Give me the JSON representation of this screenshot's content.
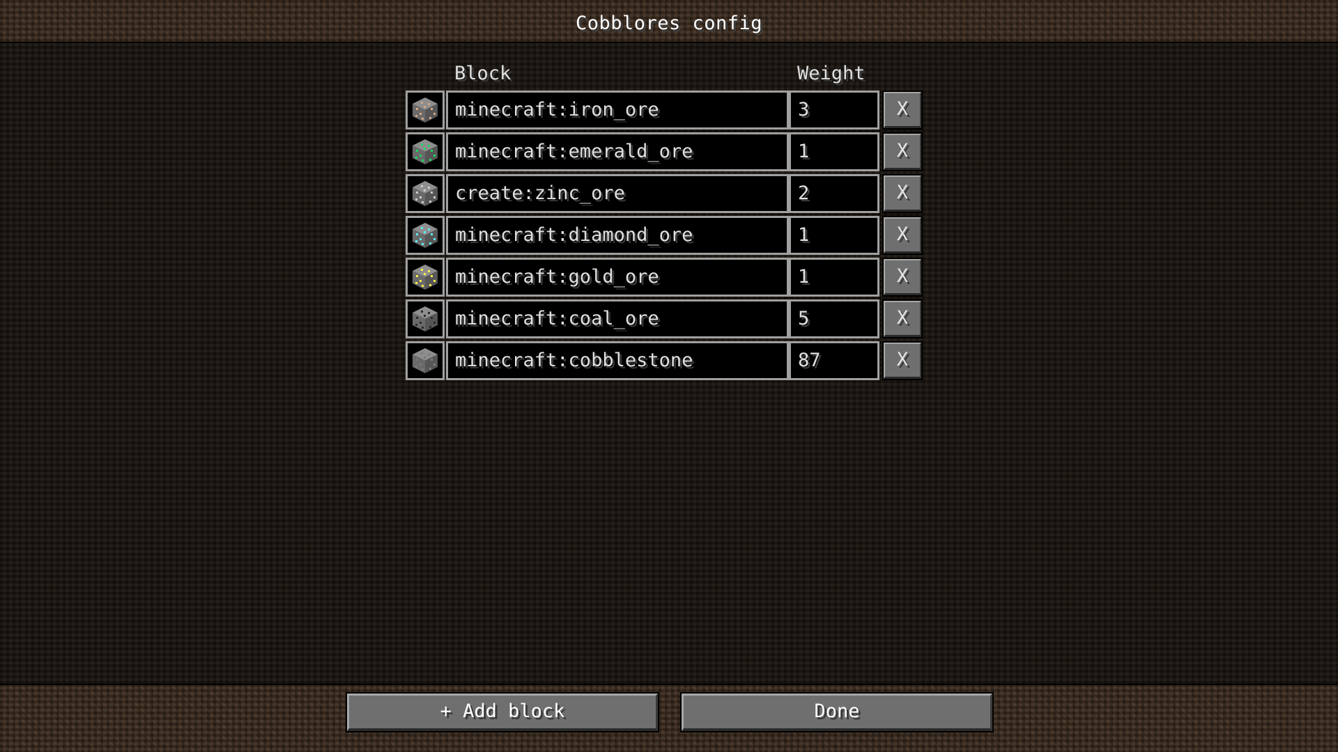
{
  "window": {
    "title": "Cobblores config"
  },
  "columns": {
    "block": "Block",
    "weight": "Weight"
  },
  "rows": [
    {
      "block": "minecraft:iron_ore",
      "weight": "3",
      "icon": "iron-ore-icon",
      "ore_color": "#d8a884",
      "remove_label": "X"
    },
    {
      "block": "minecraft:emerald_ore",
      "weight": "1",
      "icon": "emerald-ore-icon",
      "ore_color": "#17dd62",
      "remove_label": "X"
    },
    {
      "block": "create:zinc_ore",
      "weight": "2",
      "icon": "zinc-ore-icon",
      "ore_color": "#c8d0c8",
      "remove_label": "X"
    },
    {
      "block": "minecraft:diamond_ore",
      "weight": "1",
      "icon": "diamond-ore-icon",
      "ore_color": "#5decf5",
      "remove_label": "X"
    },
    {
      "block": "minecraft:gold_ore",
      "weight": "1",
      "icon": "gold-ore-icon",
      "ore_color": "#fcee4b",
      "remove_label": "X"
    },
    {
      "block": "minecraft:coal_ore",
      "weight": "5",
      "icon": "coal-ore-icon",
      "ore_color": "#2a2a2a",
      "remove_label": "X"
    },
    {
      "block": "minecraft:cobblestone",
      "weight": "87",
      "icon": "cobblestone-icon",
      "ore_color": "#7a7a7a",
      "remove_label": "X"
    }
  ],
  "footer": {
    "add_label": "+ Add block",
    "done_label": "Done"
  }
}
